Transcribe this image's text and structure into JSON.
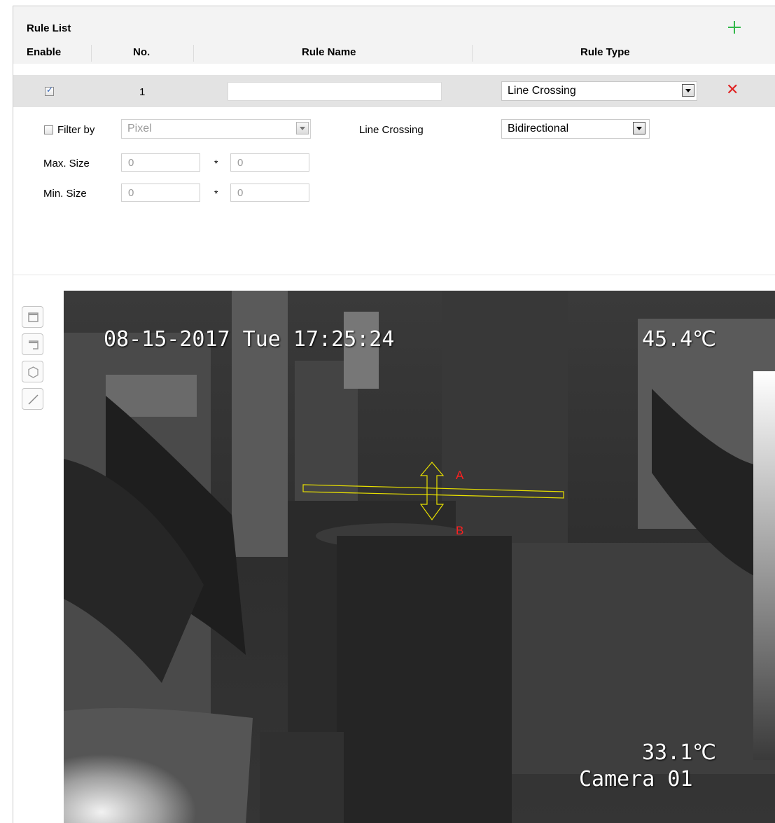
{
  "rule_list": {
    "title": "Rule List",
    "add_icon": "plus-icon",
    "columns": {
      "enable": "Enable",
      "no": "No.",
      "rule_name": "Rule Name",
      "rule_type": "Rule Type"
    },
    "rule": {
      "enabled": true,
      "no": "1",
      "name": "",
      "type": "Line Crossing",
      "delete_icon": "close-icon"
    },
    "detail": {
      "filter_label": "Filter by",
      "filter_checked": false,
      "filter_value": "Pixel",
      "line_crossing_label": "Line Crossing",
      "direction": "Bidirectional",
      "max_size_label": "Max. Size",
      "max_w": "0",
      "max_h": "0",
      "min_size_label": "Min. Size",
      "min_w": "0",
      "min_h": "0",
      "separator": "*"
    }
  },
  "toolbar": {
    "tools": [
      "rectangle-icon",
      "partial-rectangle-icon",
      "polygon-icon",
      "line-icon"
    ]
  },
  "video": {
    "timestamp": "08-15-2017 Tue 17:25:24",
    "max_temp": "45.4℃",
    "min_temp": "33.1℃",
    "camera_name": "Camera 01",
    "side_a": "A",
    "side_b": "B",
    "line_color": "#e8e000",
    "label_color": "#ff2020"
  }
}
